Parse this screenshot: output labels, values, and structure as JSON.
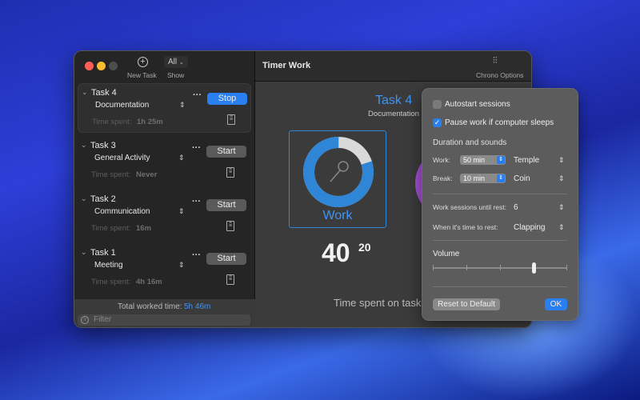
{
  "toolbar": {
    "new_task": "New Task",
    "show_value": "All",
    "show_label": "Show"
  },
  "tasks": [
    {
      "title": "Task 4",
      "category": "Documentation",
      "time_label": "Time spent:",
      "time": "1h 25m",
      "action": "Stop",
      "active": true
    },
    {
      "title": "Task 3",
      "category": "General Activity",
      "time_label": "Time spent:",
      "time": "Never",
      "action": "Start",
      "active": false
    },
    {
      "title": "Task 2",
      "category": "Communication",
      "time_label": "Time spent:",
      "time": "16m",
      "action": "Start",
      "active": false
    },
    {
      "title": "Task 1",
      "category": "Meeting",
      "time_label": "Time spent:",
      "time": "4h 16m",
      "action": "Start",
      "active": false
    }
  ],
  "footer": {
    "total_label": "Total worked time:",
    "total_value": "5h 46m",
    "filter_placeholder": "Filter"
  },
  "main": {
    "title": "Timer Work",
    "options_label": "Chrono Options",
    "task_title": "Task 4",
    "task_category": "Documentation",
    "mode": "Work",
    "progress": 0.8,
    "minutes": "40",
    "seconds": "20",
    "time_spent_label": "Time spent on task:"
  },
  "options": {
    "autostart": {
      "label": "Autostart sessions",
      "checked": false
    },
    "pause_sleep": {
      "label": "Pause work if computer sleeps",
      "checked": true
    },
    "section": "Duration and sounds",
    "work_label": "Work:",
    "work_value": "50 min",
    "work_sound": "Temple",
    "break_label": "Break:",
    "break_value": "10 min",
    "break_sound": "Coin",
    "sessions_label": "Work sessions until rest:",
    "sessions_value": "6",
    "rest_label": "When it's time to rest:",
    "rest_sound": "Clapping",
    "volume_label": "Volume",
    "volume": 0.75,
    "reset": "Reset to Default",
    "ok": "OK"
  },
  "colors": {
    "accent": "#2a7ff0",
    "ring": "#2f86d6",
    "ring_rest": "#d9d9d9"
  }
}
